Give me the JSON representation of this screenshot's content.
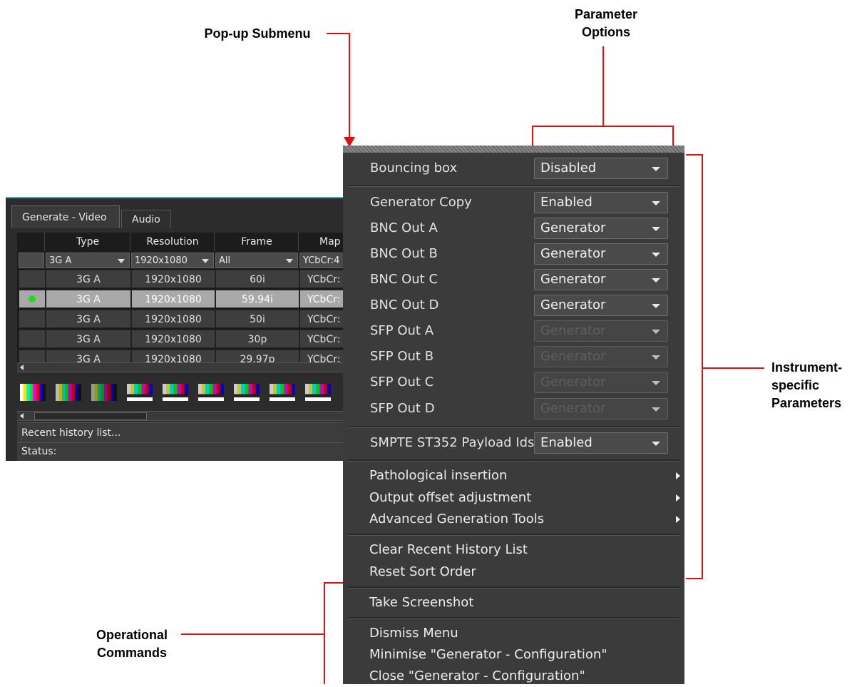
{
  "annotations": {
    "popup_submenu": "Pop-up Submenu",
    "parameter_options": "Parameter\nOptions",
    "instrument_specific": "Instrument-\nspecific\nParameters",
    "operational_commands": "Operational\nCommands",
    "line_color": "#e01010"
  },
  "window": {
    "accent_color": "#3fa7b5",
    "tabs": [
      {
        "label": "Generate - Video",
        "active": true
      },
      {
        "label": "Audio",
        "active": false
      }
    ],
    "columns": [
      "Type",
      "Resolution",
      "Frame",
      "Map"
    ],
    "filters": {
      "type": "3G A",
      "resolution": "1920x1080",
      "frame": "All",
      "map": "YCbCr:4"
    },
    "rows": [
      {
        "type": "3G A",
        "resolution": "1920x1080",
        "frame": "60i",
        "map": "YCbCr:",
        "selected": false,
        "active": false
      },
      {
        "type": "3G A",
        "resolution": "1920x1080",
        "frame": "59.94i",
        "map": "YCbCr:",
        "selected": true,
        "active": true
      },
      {
        "type": "3G A",
        "resolution": "1920x1080",
        "frame": "50i",
        "map": "YCbCr:",
        "selected": false,
        "active": false
      },
      {
        "type": "3G A",
        "resolution": "1920x1080",
        "frame": "30p",
        "map": "YCbCr:",
        "selected": false,
        "active": false
      },
      {
        "type": "3G A",
        "resolution": "1920x1080",
        "frame": "29.97p",
        "map": "YCbCr:",
        "selected": false,
        "active": false
      }
    ],
    "recent_history_label": "Recent history list...",
    "status_label": "Status:"
  },
  "menu": {
    "bouncing_box": {
      "label": "Bouncing box",
      "value": "Disabled",
      "enabled": true
    },
    "outputs": [
      {
        "label": "Generator Copy",
        "value": "Enabled",
        "enabled": true
      },
      {
        "label": "BNC Out A",
        "value": "Generator",
        "enabled": true
      },
      {
        "label": "BNC Out B",
        "value": "Generator",
        "enabled": true
      },
      {
        "label": "BNC Out C",
        "value": "Generator",
        "enabled": true
      },
      {
        "label": "BNC Out D",
        "value": "Generator",
        "enabled": true
      },
      {
        "label": "SFP Out A",
        "value": "Generator",
        "enabled": false
      },
      {
        "label": "SFP Out B",
        "value": "Generator",
        "enabled": false
      },
      {
        "label": "SFP Out C",
        "value": "Generator",
        "enabled": false
      },
      {
        "label": "SFP Out D",
        "value": "Generator",
        "enabled": false
      }
    ],
    "smpte": {
      "label": "SMPTE ST352 Payload Ids",
      "value": "Enabled",
      "enabled": true
    },
    "submenus": [
      "Pathological insertion",
      "Output offset adjustment",
      "Advanced Generation Tools"
    ],
    "history_commands": [
      "Clear Recent History List",
      "Reset Sort Order"
    ],
    "screenshot_command": "Take Screenshot",
    "window_commands": [
      "Dismiss Menu",
      "Minimise \"Generator - Configuration\"",
      "Close \"Generator - Configuration\""
    ]
  }
}
